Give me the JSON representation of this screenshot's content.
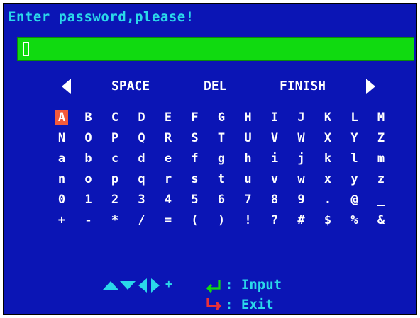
{
  "prompt": "Enter password,please!",
  "password": {
    "value": ""
  },
  "commands": {
    "space": "SPACE",
    "del": "DEL",
    "finish": "FINISH"
  },
  "keyboard": {
    "rows": [
      [
        "A",
        "B",
        "C",
        "D",
        "E",
        "F",
        "G",
        "H",
        "I",
        "J",
        "K",
        "L",
        "M"
      ],
      [
        "N",
        "O",
        "P",
        "Q",
        "R",
        "S",
        "T",
        "U",
        "V",
        "W",
        "X",
        "Y",
        "Z"
      ],
      [
        "a",
        "b",
        "c",
        "d",
        "e",
        "f",
        "g",
        "h",
        "i",
        "j",
        "k",
        "l",
        "m"
      ],
      [
        "n",
        "o",
        "p",
        "q",
        "r",
        "s",
        "t",
        "u",
        "v",
        "w",
        "x",
        "y",
        "z"
      ],
      [
        "0",
        "1",
        "2",
        "3",
        "4",
        "5",
        "6",
        "7",
        "8",
        "9",
        ".",
        "@",
        "_"
      ],
      [
        "+",
        "-",
        "*",
        "/",
        "=",
        "(",
        ")",
        "!",
        "?",
        "#",
        "$",
        "%",
        "&"
      ]
    ],
    "selected": "A"
  },
  "help": {
    "nav_plus": "+",
    "input_label": ": Input",
    "exit_label": ": Exit"
  },
  "colors": {
    "background": "#0b15b5",
    "prompt_text": "#2ad8ea",
    "input_field": "#10da10",
    "selected_key": "#f45a3a",
    "enter_icon": "#10da10",
    "exit_icon": "#e8303a"
  },
  "icons": {
    "left": "triangle-left-icon",
    "right": "triangle-right-icon",
    "up": "triangle-up-icon",
    "down": "triangle-down-icon",
    "enter": "enter-return-icon",
    "exit": "exit-return-icon"
  }
}
